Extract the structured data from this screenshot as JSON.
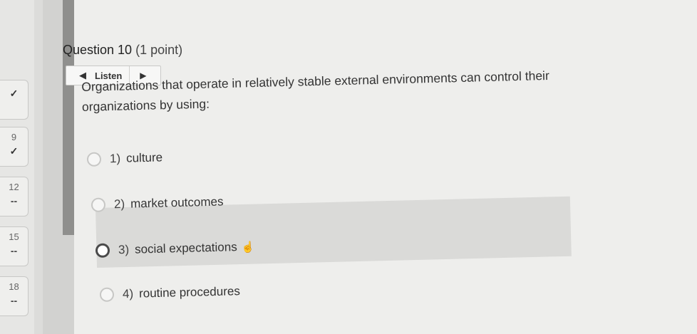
{
  "navigator": {
    "items": [
      {
        "number": "",
        "mark": "✓"
      },
      {
        "number": "9",
        "mark": "✓"
      },
      {
        "number": "12",
        "mark": "--"
      },
      {
        "number": "15",
        "mark": "--"
      },
      {
        "number": "18",
        "mark": "--"
      }
    ]
  },
  "question": {
    "title": "Question 10",
    "points": "(1 point)",
    "listen_label": "Listen",
    "prompt": "Organizations that operate in relatively stable external environments can control their organizations by using:",
    "options": [
      {
        "number": "1)",
        "text": "culture"
      },
      {
        "number": "2)",
        "text": "market outcomes"
      },
      {
        "number": "3)",
        "text": "social expectations"
      },
      {
        "number": "4)",
        "text": "routine procedures"
      }
    ]
  }
}
